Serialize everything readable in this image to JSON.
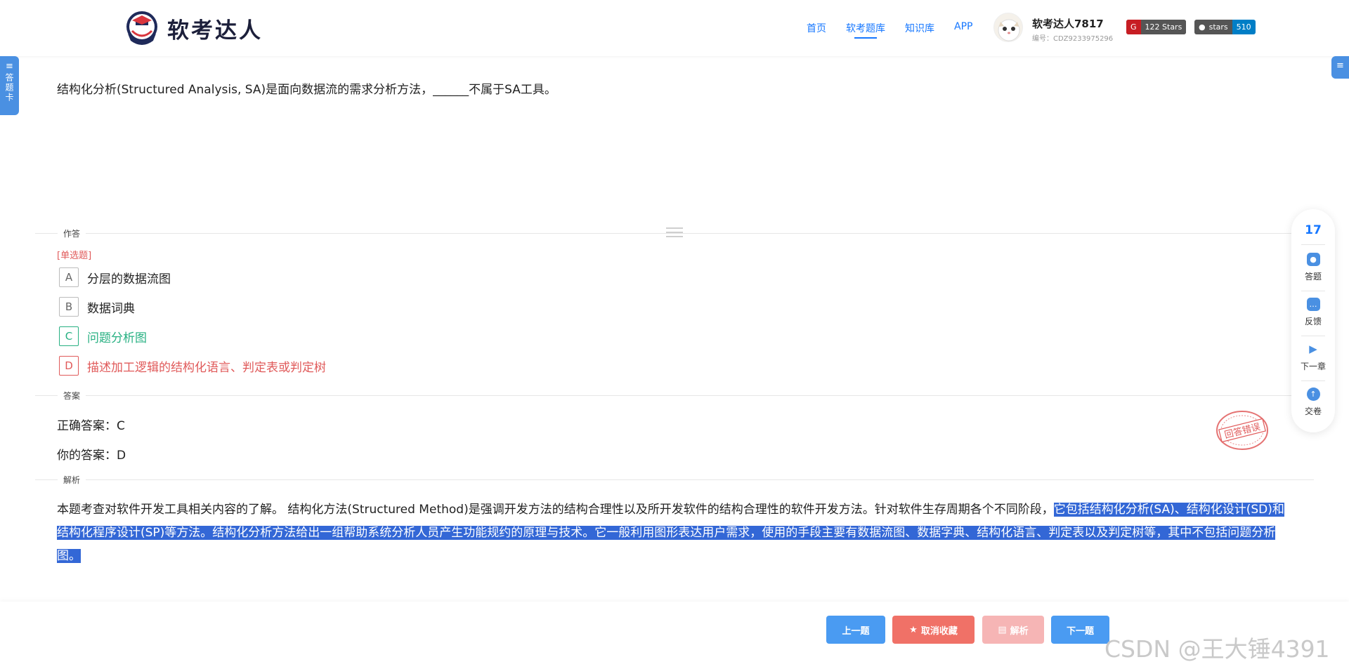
{
  "header": {
    "logo_text": "软考达人",
    "nav": [
      {
        "label": "首页",
        "active": false
      },
      {
        "label": "软考题库",
        "active": true
      },
      {
        "label": "知识库",
        "active": false
      },
      {
        "label": "APP",
        "active": false
      }
    ],
    "user": {
      "name": "软考达人7817",
      "id": "编号：CDZ9233975296"
    },
    "badges": {
      "gitee": {
        "label": "122 Stars"
      },
      "github": {
        "left": "stars",
        "right": "510"
      }
    }
  },
  "left_tab": {
    "label": "答题卡"
  },
  "question": {
    "text": "结构化分析(Structured Analysis, SA)是面向数据流的需求分析方法，______不属于SA工具。",
    "type_label": "[单选题]",
    "options": [
      {
        "letter": "A",
        "text": "分层的数据流图",
        "state": "normal"
      },
      {
        "letter": "B",
        "text": "数据词典",
        "state": "normal"
      },
      {
        "letter": "C",
        "text": "问题分析图",
        "state": "correct"
      },
      {
        "letter": "D",
        "text": "描述加工逻辑的结构化语言、判定表或判定树",
        "state": "wrong"
      }
    ]
  },
  "sections": {
    "answer_area": "作答",
    "answer": "答案",
    "analysis": "解析"
  },
  "answer": {
    "correct": "正确答案：C",
    "yours": "你的答案：D"
  },
  "stamp_text": "回答错误",
  "analysis": {
    "plain": "本题考查对软件开发工具相关内容的了解。    结构化方法(Structured Method)是强调开发方法的结构合理性以及所开发软件的结构合理性的软件开发方法。针对软件生存周期各个不同阶段，",
    "highlighted": "它包括结构化分析(SA)、结构化设计(SD)和结构化程序设计(SP)等方法。结构化分析方法给出一组帮助系统分析人员产生功能规约的原理与技术。它一般利用图形表达用户需求，使用的手段主要有数据流图、数据字典、结构化语言、判定表以及判定树等，其中不包括问题分析图。"
  },
  "right_bar": {
    "count": "17",
    "items": [
      {
        "label": "答题",
        "icon": "answer-icon"
      },
      {
        "label": "反馈",
        "icon": "feedback-icon"
      },
      {
        "label": "下一章",
        "icon": "next-chapter-icon"
      },
      {
        "label": "交卷",
        "icon": "submit-icon"
      }
    ]
  },
  "bottom": {
    "prev": "上一题",
    "fav": "取消收藏",
    "analysis": "解析",
    "next": "下一题"
  },
  "watermark": "CSDN @王大锤4391",
  "colors": {
    "accent": "#1677ff",
    "correct": "#27b082",
    "wrong": "#e05a5a",
    "highlight": "#3367d6"
  }
}
